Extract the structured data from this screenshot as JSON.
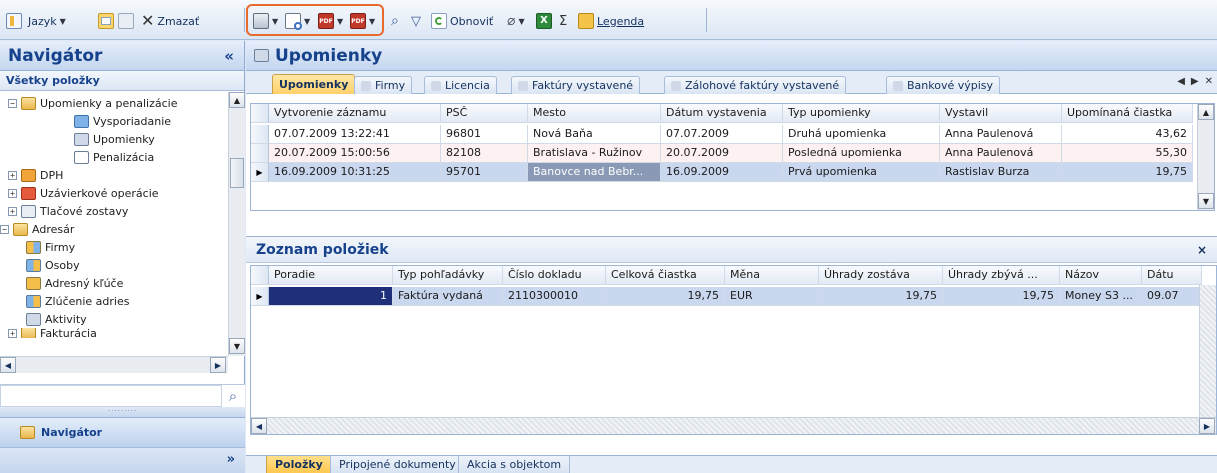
{
  "toolbar": {
    "language_label": "Jazyk",
    "delete_label": "Zmazať",
    "refresh_label": "Obnoviť",
    "legend_label": "Legenda",
    "highlight_color": "#e96a2d"
  },
  "navigator": {
    "title": "Navigátor",
    "collapse_glyph": "«",
    "subtitle": "Všetky položky",
    "tree": [
      {
        "label": "Upomienky a penalizácie",
        "expander": "−"
      },
      {
        "label": "Vysporiadanie"
      },
      {
        "label": "Upomienky"
      },
      {
        "label": "Penalizácia"
      },
      {
        "label": "DPH",
        "expander": "+"
      },
      {
        "label": "Uzávierkové operácie",
        "expander": "+"
      },
      {
        "label": "Tlačové zostavy",
        "expander": "+"
      },
      {
        "label": "Adresár",
        "expander": "−"
      },
      {
        "label": "Firmy"
      },
      {
        "label": "Osoby"
      },
      {
        "label": "Adresný kľúče"
      },
      {
        "label": "Zlúčenie adries"
      },
      {
        "label": "Aktivity"
      },
      {
        "label": "Fakturácia",
        "expander": "+"
      }
    ],
    "dots": "·········",
    "pane_button_label": "Navigátor",
    "more_glyph": "»"
  },
  "main": {
    "title": "Upomienky",
    "tabs": [
      "Upomienky",
      "Firmy",
      "Licencia",
      "Faktúry vystavené",
      "Zálohové faktúry vystavené",
      "Bankové výpisy"
    ],
    "top_grid": {
      "columns": [
        "Vytvorenie záznamu",
        "PSČ",
        "Mesto",
        "Dátum vystavenia",
        "Typ upomienky",
        "Vystavil",
        "Upomínaná čiastka"
      ],
      "rows": [
        [
          "07.07.2009 13:22:41",
          "96801",
          "Nová Baňa",
          "07.07.2009",
          "Druhá upomienka",
          "Anna Paulenová",
          "43,62"
        ],
        [
          "20.07.2009 15:00:56",
          "82108",
          "Bratislava - Ružinov",
          "20.07.2009",
          "Posledná upomienka",
          "Anna Paulenová",
          "55,30"
        ],
        [
          "16.09.2009 10:31:25",
          "95701",
          "Banovce nad Bebr...",
          "16.09.2009",
          "Prvá upomienka",
          "Rastislav Burza",
          "19,75"
        ]
      ]
    },
    "items_section": {
      "title": "Zoznam položiek",
      "close_glyph": "×",
      "columns": [
        "Poradie",
        "Typ pohľadávky",
        "Číslo dokladu",
        "Celková čiastka",
        "Měna",
        "Úhrady zostáva",
        "Úhrady zbývá ...",
        "Názov",
        "Dátu"
      ],
      "rows": [
        [
          "1",
          "Faktúra vydaná",
          "2110300010",
          "19,75",
          "EUR",
          "19,75",
          "19,75",
          "Money S3 ...",
          "09.07"
        ]
      ]
    },
    "bottom_tabs": [
      "Položky",
      "Pripojené dokumenty",
      "Akcia s objektom"
    ]
  }
}
